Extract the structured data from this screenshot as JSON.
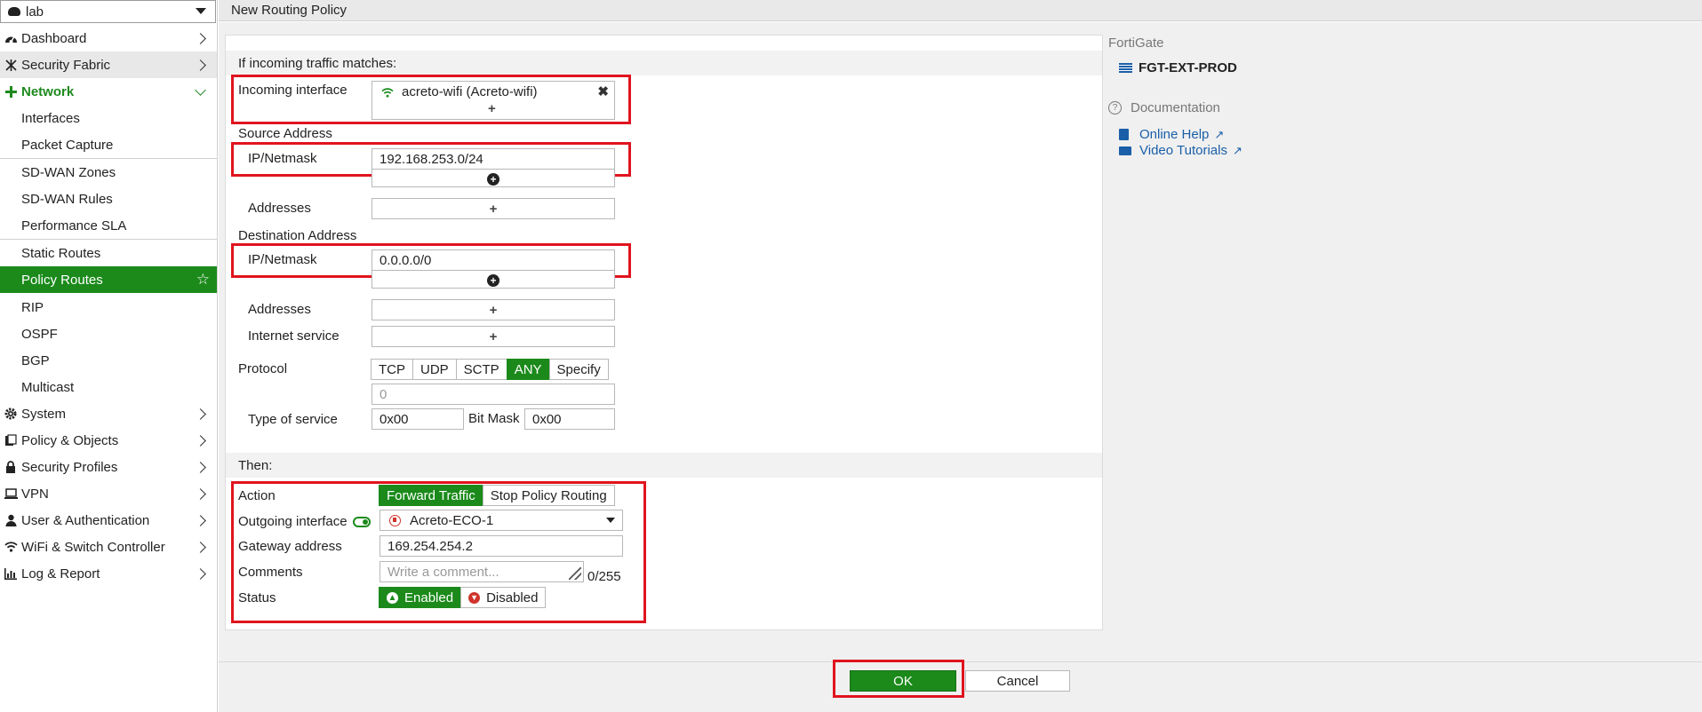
{
  "vdom": {
    "value": "lab"
  },
  "sidebar": {
    "items": [
      {
        "label": "Dashboard",
        "icon": "dashboard-icon"
      },
      {
        "label": "Security Fabric",
        "icon": "security-fabric-icon"
      },
      {
        "label": "Network",
        "icon": "network-icon"
      },
      {
        "label": "Interfaces"
      },
      {
        "label": "Packet Capture"
      },
      {
        "label": "SD-WAN Zones"
      },
      {
        "label": "SD-WAN Rules"
      },
      {
        "label": "Performance SLA"
      },
      {
        "label": "Static Routes"
      },
      {
        "label": "Policy Routes"
      },
      {
        "label": "RIP"
      },
      {
        "label": "OSPF"
      },
      {
        "label": "BGP"
      },
      {
        "label": "Multicast"
      },
      {
        "label": "System",
        "icon": "gear-icon"
      },
      {
        "label": "Policy & Objects",
        "icon": "policy-icon"
      },
      {
        "label": "Security Profiles",
        "icon": "lock-icon"
      },
      {
        "label": "VPN",
        "icon": "laptop-icon"
      },
      {
        "label": "User & Authentication",
        "icon": "user-icon"
      },
      {
        "label": "WiFi & Switch Controller",
        "icon": "wifi-icon"
      },
      {
        "label": "Log & Report",
        "icon": "chart-icon"
      }
    ]
  },
  "header": {
    "title": "New Routing Policy"
  },
  "form": {
    "match_heading": "If incoming traffic matches:",
    "incoming_interface_label": "Incoming interface",
    "incoming_interface_value": "acreto-wifi (Acreto-wifi)",
    "source_address_heading": "Source Address",
    "ipnetmask_label": "IP/Netmask",
    "source_ip": "192.168.253.0/24",
    "addresses_label": "Addresses",
    "destination_address_heading": "Destination Address",
    "destination_ip": "0.0.0.0/0",
    "internet_service_label": "Internet service",
    "protocol_label": "Protocol",
    "protocol_options": [
      "TCP",
      "UDP",
      "SCTP",
      "ANY",
      "Specify"
    ],
    "protocol_selected": "ANY",
    "protocol_number_placeholder": "0",
    "tos_label": "Type of service",
    "tos_value": "0x00",
    "bitmask_label": "Bit Mask",
    "bitmask_value": "0x00",
    "then_heading": "Then:",
    "action_label": "Action",
    "action_options": [
      "Forward Traffic",
      "Stop Policy Routing"
    ],
    "action_selected": "Forward Traffic",
    "outgoing_interface_label": "Outgoing interface",
    "outgoing_interface_value": "Acreto-ECO-1",
    "gateway_label": "Gateway address",
    "gateway_value": "169.254.254.2",
    "comments_label": "Comments",
    "comments_placeholder": "Write a comment...",
    "comments_counter": "0/255",
    "status_label": "Status",
    "status_enabled": "Enabled",
    "status_disabled": "Disabled",
    "status_selected": "Enabled"
  },
  "info": {
    "fortigate_label": "FortiGate",
    "device_name": "FGT-EXT-PROD",
    "documentation_label": "Documentation",
    "online_help": "Online Help",
    "video_tutorials": "Video Tutorials"
  },
  "footer": {
    "ok_label": "OK",
    "cancel_label": "Cancel"
  },
  "colors": {
    "accent": "#1b8a1b",
    "highlight": "#e0141e",
    "link": "#1a5fa8"
  }
}
